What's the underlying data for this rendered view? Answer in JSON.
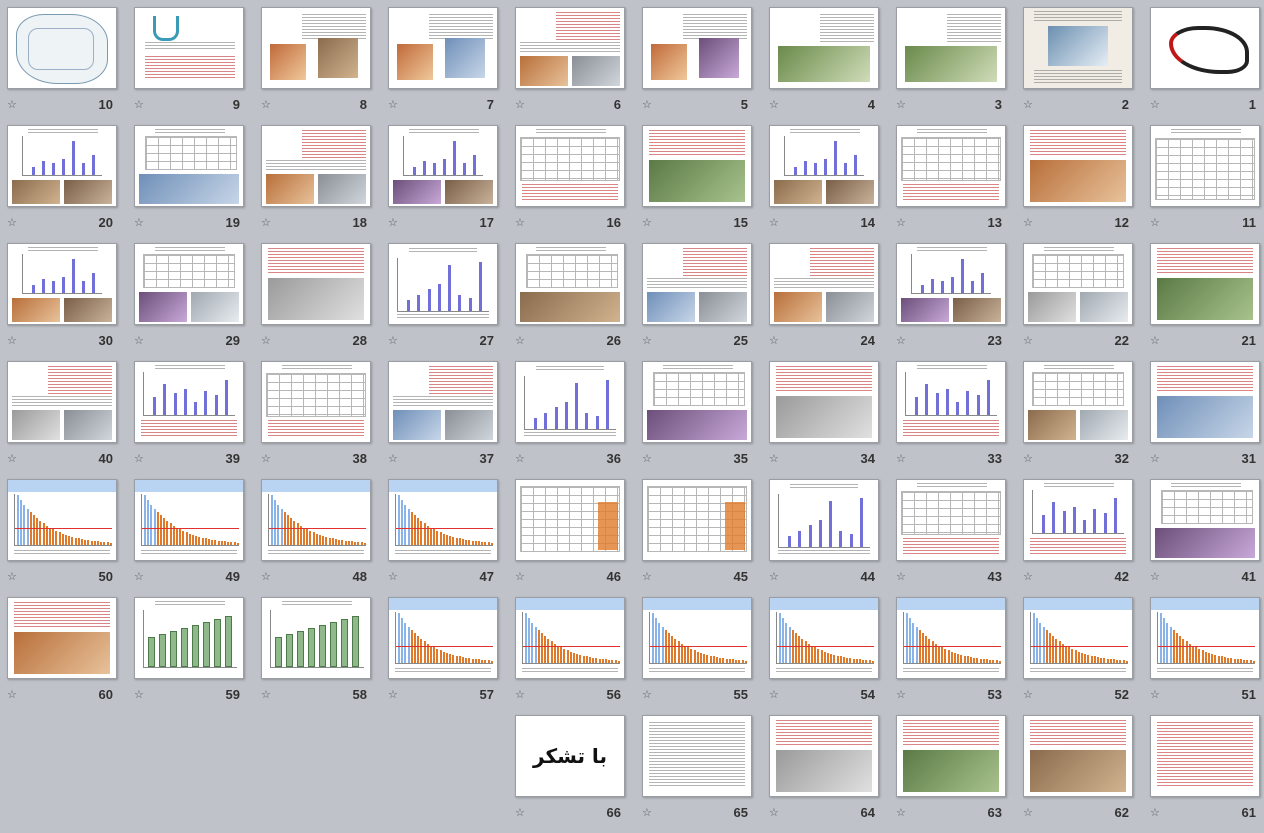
{
  "view": "slide-sorter",
  "star_glyph": "☆",
  "thanks_text": "با تشکر",
  "slides": [
    {
      "n": "1",
      "t": "calligraphy"
    },
    {
      "n": "2",
      "t": "photo-title"
    },
    {
      "n": "3",
      "t": "list-photo"
    },
    {
      "n": "4",
      "t": "list-photos"
    },
    {
      "n": "5",
      "t": "collage"
    },
    {
      "n": "6",
      "t": "text-photos"
    },
    {
      "n": "7",
      "t": "diagram"
    },
    {
      "n": "8",
      "t": "text-illus"
    },
    {
      "n": "9",
      "t": "logo"
    },
    {
      "n": "10",
      "t": "map"
    },
    {
      "n": "11",
      "t": "table"
    },
    {
      "n": "12",
      "t": "text-photo"
    },
    {
      "n": "13",
      "t": "table-text"
    },
    {
      "n": "14",
      "t": "chart-photos"
    },
    {
      "n": "15",
      "t": "text-photo"
    },
    {
      "n": "16",
      "t": "table-text"
    },
    {
      "n": "17",
      "t": "chart-photos"
    },
    {
      "n": "18",
      "t": "text-photos"
    },
    {
      "n": "19",
      "t": "table-photo"
    },
    {
      "n": "20",
      "t": "chart-photos"
    },
    {
      "n": "21",
      "t": "text-photo"
    },
    {
      "n": "22",
      "t": "table-photos"
    },
    {
      "n": "23",
      "t": "chart-photos"
    },
    {
      "n": "24",
      "t": "text-photos"
    },
    {
      "n": "25",
      "t": "text-photos"
    },
    {
      "n": "26",
      "t": "table-photo"
    },
    {
      "n": "27",
      "t": "chart"
    },
    {
      "n": "28",
      "t": "text-photo"
    },
    {
      "n": "29",
      "t": "table-photos"
    },
    {
      "n": "30",
      "t": "chart-photo"
    },
    {
      "n": "31",
      "t": "text-photo"
    },
    {
      "n": "32",
      "t": "table-photos"
    },
    {
      "n": "33",
      "t": "chart-text"
    },
    {
      "n": "34",
      "t": "text-photo"
    },
    {
      "n": "35",
      "t": "table-photo"
    },
    {
      "n": "36",
      "t": "chart"
    },
    {
      "n": "37",
      "t": "text-photos"
    },
    {
      "n": "38",
      "t": "table-text"
    },
    {
      "n": "39",
      "t": "chart-text"
    },
    {
      "n": "40",
      "t": "text-photos"
    },
    {
      "n": "41",
      "t": "table-photo"
    },
    {
      "n": "42",
      "t": "chart-text"
    },
    {
      "n": "43",
      "t": "table-text"
    },
    {
      "n": "44",
      "t": "chart"
    },
    {
      "n": "45",
      "t": "big-table"
    },
    {
      "n": "46",
      "t": "big-table"
    },
    {
      "n": "47",
      "t": "hbar"
    },
    {
      "n": "48",
      "t": "hbar"
    },
    {
      "n": "49",
      "t": "hbar"
    },
    {
      "n": "50",
      "t": "hbar"
    },
    {
      "n": "51",
      "t": "hbar"
    },
    {
      "n": "52",
      "t": "hbar"
    },
    {
      "n": "53",
      "t": "hbar"
    },
    {
      "n": "54",
      "t": "hbar"
    },
    {
      "n": "55",
      "t": "hbar"
    },
    {
      "n": "56",
      "t": "hbar"
    },
    {
      "n": "57",
      "t": "hbar"
    },
    {
      "n": "58",
      "t": "green"
    },
    {
      "n": "59",
      "t": "green"
    },
    {
      "n": "60",
      "t": "text-photo"
    },
    {
      "n": "61",
      "t": "text"
    },
    {
      "n": "62",
      "t": "text-photo"
    },
    {
      "n": "63",
      "t": "text-photo"
    },
    {
      "n": "64",
      "t": "text-photo"
    },
    {
      "n": "65",
      "t": "refs"
    },
    {
      "n": "66",
      "t": "thanks"
    }
  ]
}
